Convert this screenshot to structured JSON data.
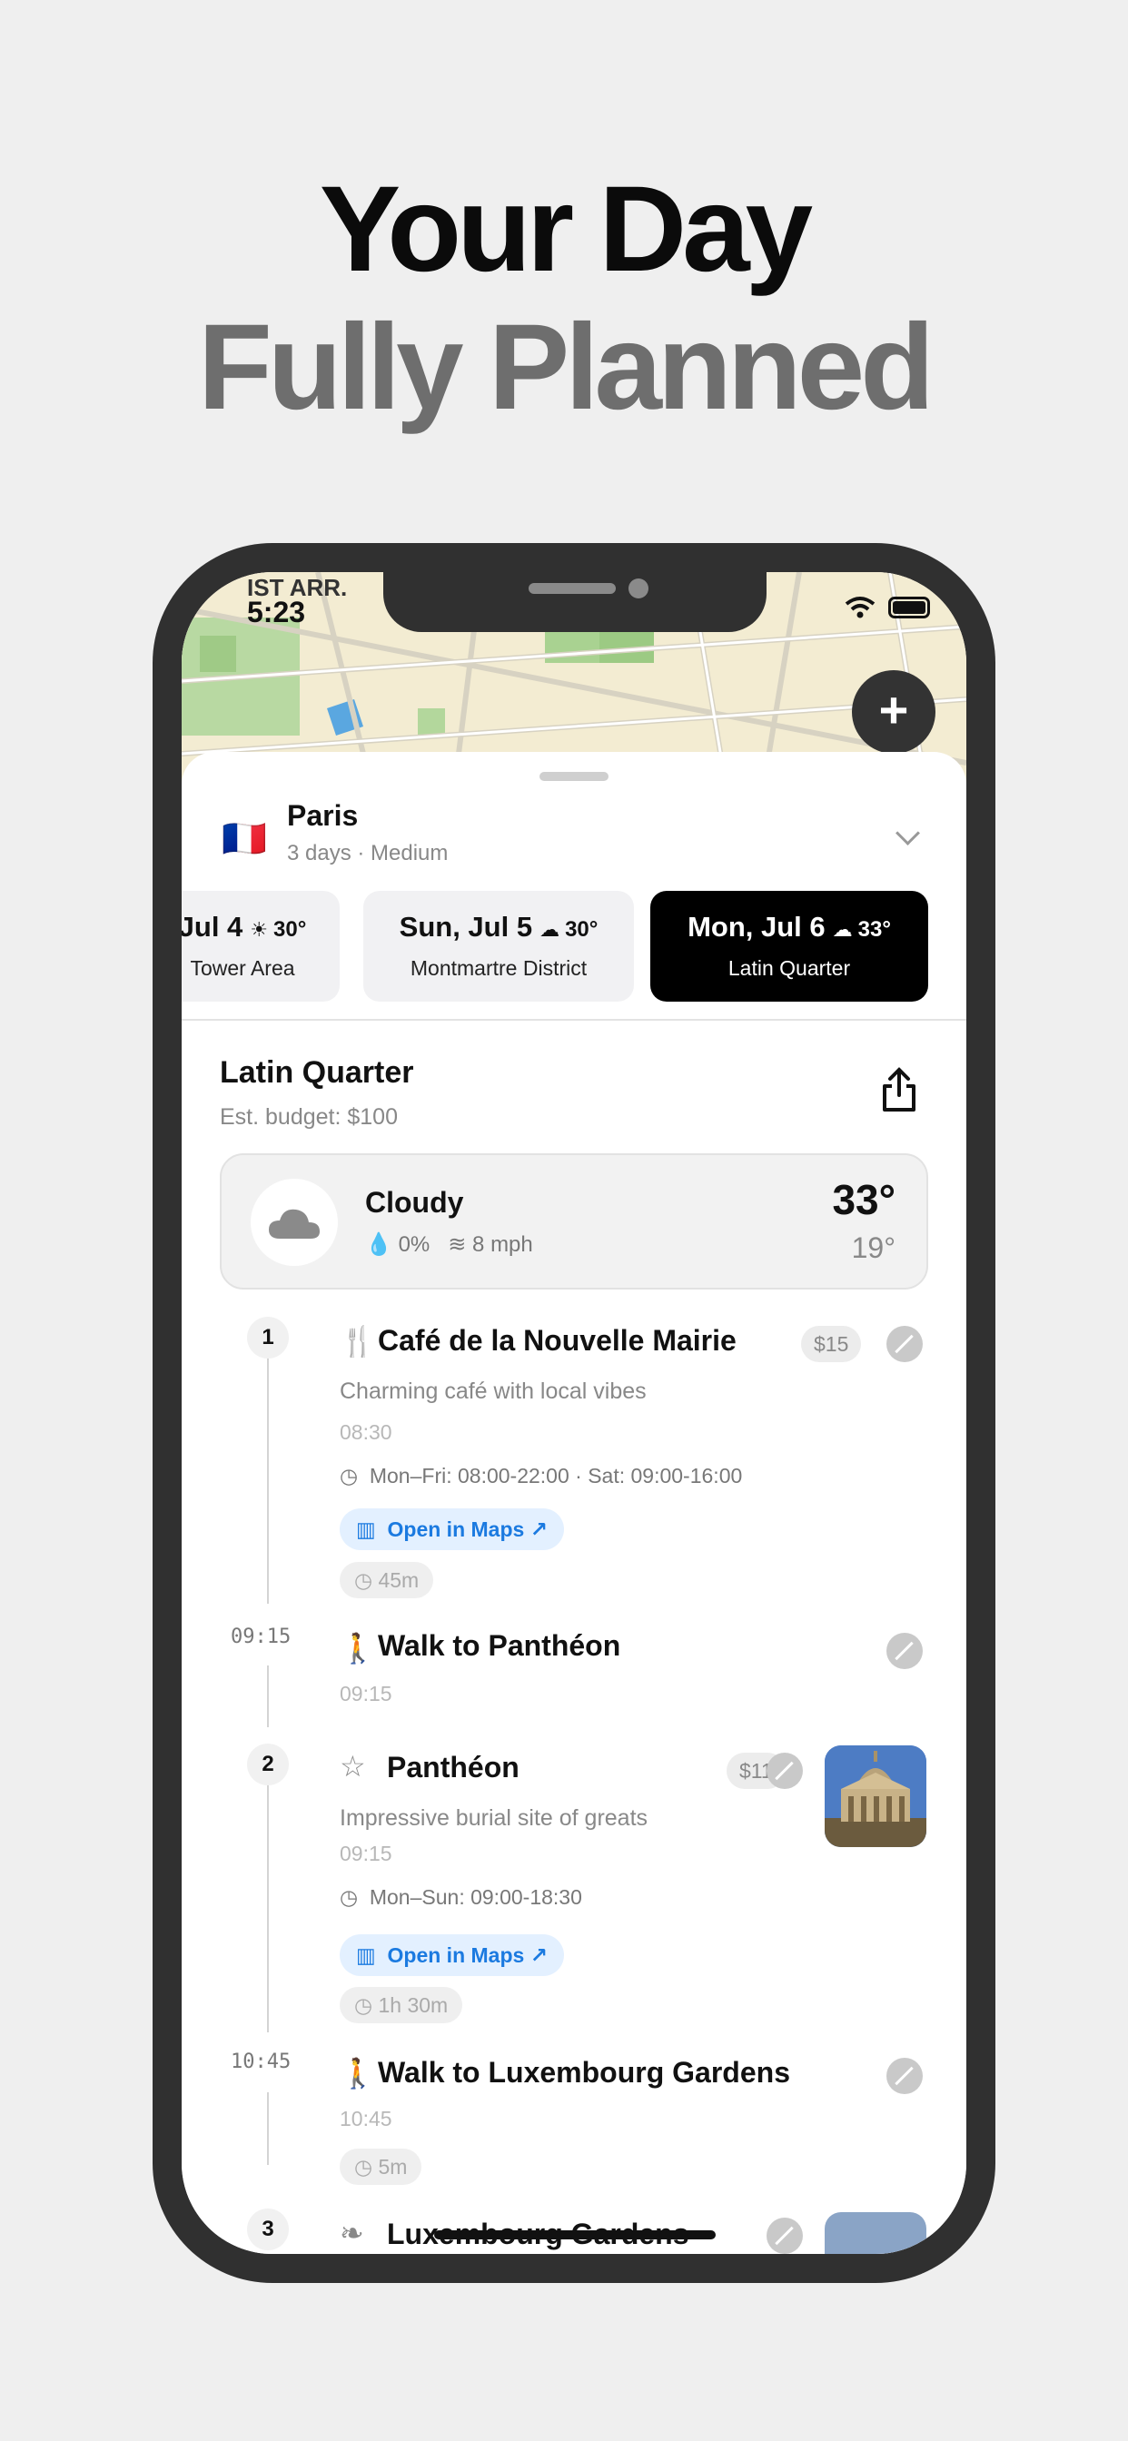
{
  "headline": {
    "line1": "Your Day",
    "line2": "Fully Planned"
  },
  "status": {
    "time": "5:23",
    "partial_label": "IST ARR."
  },
  "fab": {
    "label": "+"
  },
  "trip": {
    "flag": "🇫🇷",
    "city": "Paris",
    "meta": "3 days · Medium"
  },
  "days": [
    {
      "date": "Jul 4",
      "weather_icon": "sun-icon",
      "temp": "30°",
      "area": "Tower Area",
      "selected": false
    },
    {
      "date": "Sun, Jul 5",
      "weather_icon": "cloud-icon",
      "temp": "30°",
      "area": "Montmartre District",
      "selected": false
    },
    {
      "date": "Mon, Jul 6",
      "weather_icon": "cloud-icon",
      "temp": "33°",
      "area": "Latin Quarter",
      "selected": true
    }
  ],
  "section": {
    "title": "Latin Quarter",
    "budget": "Est. budget: $100"
  },
  "weather": {
    "condition": "Cloudy",
    "precip": "0%",
    "wind": "8 mph",
    "high": "33°",
    "low": "19°"
  },
  "items": [
    {
      "num": "1",
      "icon": "fork-knife-icon",
      "title": "Café de la Nouvelle Mairie",
      "price": "$15",
      "desc": "Charming café with local vibes",
      "time": "08:30",
      "hours": "Mon–Fri: 08:00-22:00 · Sat: 09:00-16:00",
      "maps": "Open in Maps",
      "duration": "45m"
    },
    {
      "ttime": "09:15",
      "icon": "walk-icon",
      "title": "Walk to Panthéon",
      "time": "09:15"
    },
    {
      "num": "2",
      "icon": "star-icon",
      "title": "Panthéon",
      "price": "$11",
      "desc": "Impressive burial site of greats",
      "time": "09:15",
      "hours": "Mon–Sun: 09:00-18:30",
      "maps": "Open in Maps",
      "duration": "1h 30m"
    },
    {
      "ttime": "10:45",
      "icon": "walk-icon",
      "title": "Walk to Luxembourg Gardens",
      "time": "10:45",
      "duration": "5m"
    },
    {
      "num": "3",
      "icon": "leaf-icon",
      "title": "Luxembourg Gardens"
    }
  ]
}
